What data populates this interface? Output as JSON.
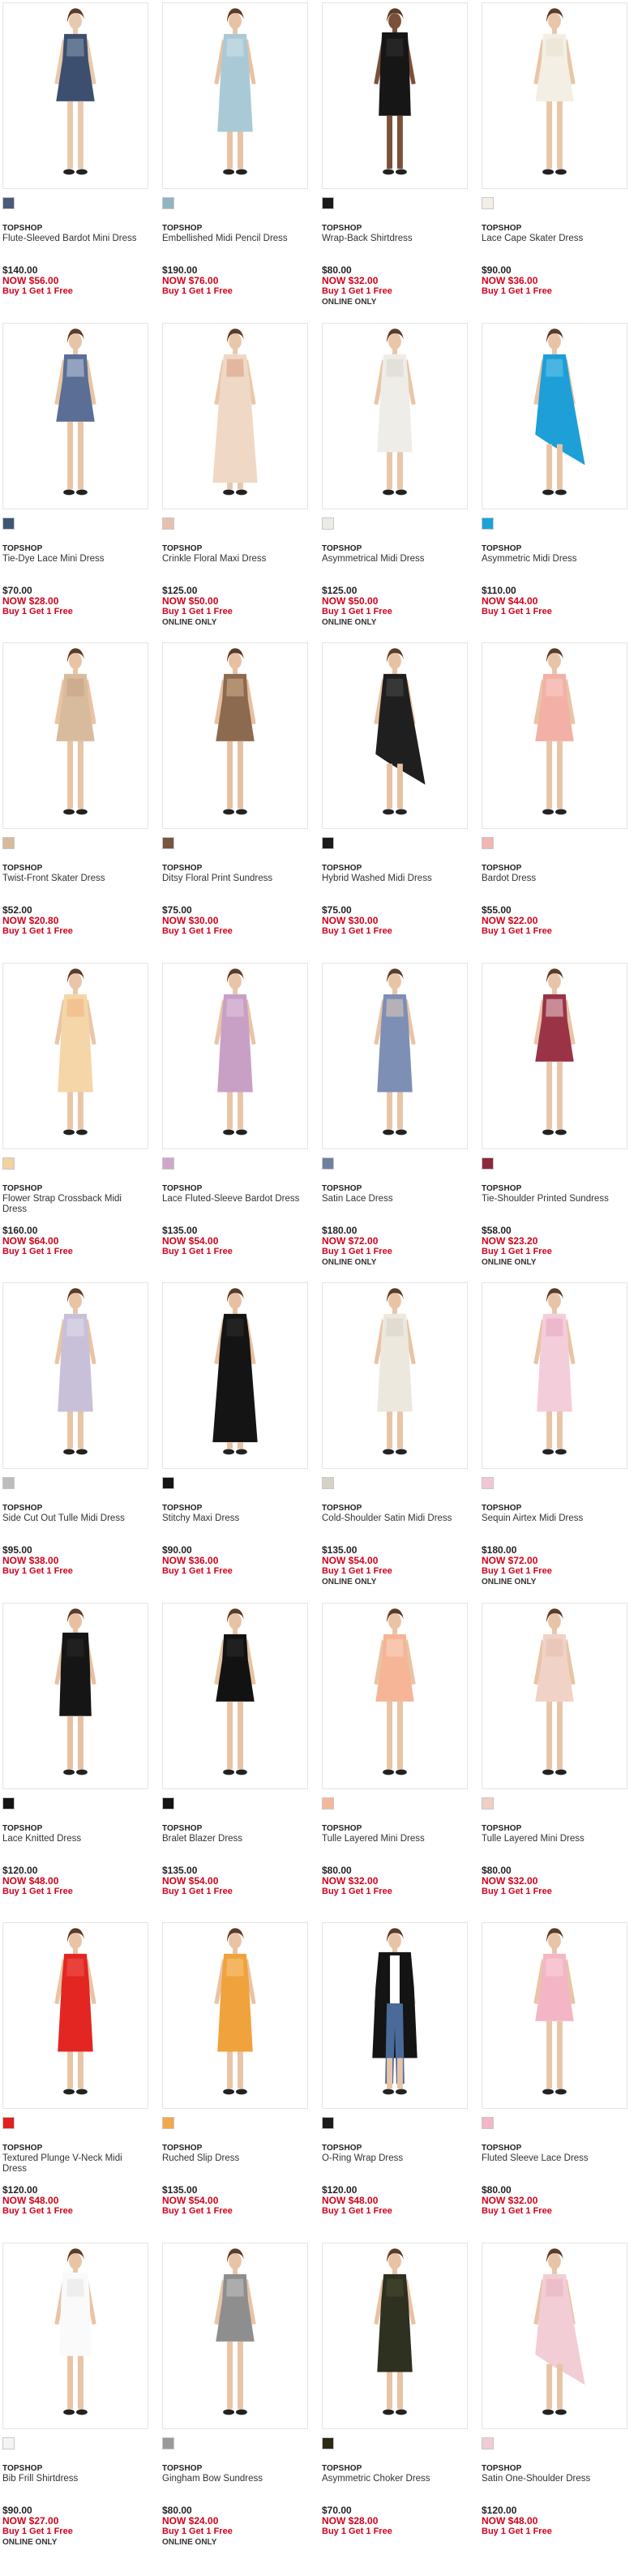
{
  "labels": {
    "now_prefix": "NOW",
    "online_only": "ONLINE ONLY"
  },
  "products": [
    {
      "brand": "TOPSHOP",
      "name": "Flute-Sleeved Bardot Mini Dress",
      "price": "$140.00",
      "now": "NOW  $56.00",
      "promo": "Buy 1 Get 1 Free",
      "online": "",
      "swatch": "#4a5a7a",
      "garment": "#3d4f6f",
      "garment_alt": "#8aa0b8",
      "skin": "#e9c9ad",
      "style": "mini"
    },
    {
      "brand": "TOPSHOP",
      "name": "Embellished Midi Pencil Dress",
      "price": "$190.00",
      "now": "NOW  $76.00",
      "promo": "Buy 1 Get 1 Free",
      "online": "",
      "swatch": "#8fb5c4",
      "garment": "#a9c9d6",
      "garment_alt": "#cfe2ea",
      "skin": "#e7c2a4",
      "style": "midi"
    },
    {
      "brand": "TOPSHOP",
      "name": "Wrap-Back Shirtdress",
      "price": "$80.00",
      "now": "NOW  $32.00",
      "promo": "Buy 1 Get 1 Free",
      "online": "ONLINE ONLY",
      "swatch": "#1a1a1a",
      "garment": "#161616",
      "garment_alt": "#333333",
      "skin": "#7a5038",
      "style": "shirt"
    },
    {
      "brand": "TOPSHOP",
      "name": "Lace Cape Skater Dress",
      "price": "$90.00",
      "now": "NOW  $36.00",
      "promo": "Buy 1 Get 1 Free",
      "online": "",
      "swatch": "#f2efe6",
      "garment": "#f3efe4",
      "garment_alt": "#e6e0d0",
      "skin": "#e8c6a8",
      "style": "mini"
    },
    {
      "brand": "TOPSHOP",
      "name": "Tie-Dye Lace Mini Dress",
      "price": "$70.00",
      "now": "NOW  $28.00",
      "promo": "Buy 1 Get 1 Free",
      "online": "",
      "swatch": "#3f5577",
      "garment": "#5a6e96",
      "garment_alt": "#c2cde0",
      "skin": "#e8c4a6",
      "style": "mini"
    },
    {
      "brand": "TOPSHOP",
      "name": "Crinkle Floral Maxi Dress",
      "price": "$125.00",
      "now": "NOW  $50.00",
      "promo": "Buy 1 Get 1 Free",
      "online": "ONLINE ONLY",
      "swatch": "#e8c0b0",
      "garment": "#efd8c6",
      "garment_alt": "#d99c80",
      "skin": "#e9c7aa",
      "style": "maxi"
    },
    {
      "brand": "TOPSHOP",
      "name": "Asymmetrical Midi Dress",
      "price": "$125.00",
      "now": "NOW  $50.00",
      "promo": "Buy 1 Get 1 Free",
      "online": "ONLINE ONLY",
      "swatch": "#ecebe8",
      "garment": "#efede8",
      "garment_alt": "#d9d6ce",
      "skin": "#e8c6a7",
      "style": "midi"
    },
    {
      "brand": "TOPSHOP",
      "name": "Asymmetric Midi Dress",
      "price": "$110.00",
      "now": "NOW  $44.00",
      "promo": "Buy 1 Get 1 Free",
      "online": "",
      "swatch": "#1aa3d8",
      "garment": "#1e9fd8",
      "garment_alt": "#6cc7ec",
      "skin": "#e8c4a5",
      "style": "asym"
    },
    {
      "brand": "TOPSHOP",
      "name": "Twist-Front Skater Dress",
      "price": "$52.00",
      "now": "NOW  $20.80",
      "promo": "Buy 1 Get 1 Free",
      "online": "",
      "swatch": "#d8b99a",
      "garment": "#d8bb9c",
      "garment_alt": "#c4a381",
      "skin": "#e8c4a4",
      "style": "mini"
    },
    {
      "brand": "TOPSHOP",
      "name": "Ditsy Floral Print Sundress",
      "price": "$75.00",
      "now": "NOW  $30.00",
      "promo": "Buy 1 Get 1 Free",
      "online": "",
      "swatch": "#7a5640",
      "garment": "#8c6a50",
      "garment_alt": "#d4b08c",
      "skin": "#e6c0a0",
      "style": "mini"
    },
    {
      "brand": "TOPSHOP",
      "name": "Hybrid Washed Midi Dress",
      "price": "$75.00",
      "now": "NOW  $30.00",
      "promo": "Buy 1 Get 1 Free",
      "online": "",
      "swatch": "#1b1b1b",
      "garment": "#1f1f1f",
      "garment_alt": "#4a4a4a",
      "skin": "#e6c2a2",
      "style": "asym"
    },
    {
      "brand": "TOPSHOP",
      "name": "Bardot Dress",
      "price": "$55.00",
      "now": "NOW  $22.00",
      "promo": "Buy 1 Get 1 Free",
      "online": "",
      "swatch": "#f0b7b0",
      "garment": "#f2b0a6",
      "garment_alt": "#f7cfc8",
      "skin": "#e8c4a6",
      "style": "mini"
    },
    {
      "brand": "TOPSHOP",
      "name": "Flower Strap Crossback Midi Dress",
      "price": "$160.00",
      "now": "NOW  $64.00",
      "promo": "Buy 1 Get 1 Free",
      "online": "",
      "swatch": "#f3d2a0",
      "garment": "#f4d6a8",
      "garment_alt": "#f0b47c",
      "skin": "#e9c6a7",
      "style": "midi"
    },
    {
      "brand": "TOPSHOP",
      "name": "Lace Fluted-Sleeve Bardot Dress",
      "price": "$135.00",
      "now": "NOW  $54.00",
      "promo": "Buy 1 Get 1 Free",
      "online": "",
      "swatch": "#cfa6cc",
      "garment": "#c8a0c6",
      "garment_alt": "#e4c8e2",
      "skin": "#e8c5a8",
      "style": "midi"
    },
    {
      "brand": "TOPSHOP",
      "name": "Satin Lace Dress",
      "price": "$180.00",
      "now": "NOW  $72.00",
      "promo": "Buy 1 Get 1 Free",
      "online": "ONLINE ONLY",
      "swatch": "#6f7fa3",
      "garment": "#7d8fb5",
      "garment_alt": "#e6cdb8",
      "skin": "#e8c4a6",
      "style": "midi"
    },
    {
      "brand": "TOPSHOP",
      "name": "Tie-Shoulder Printed Sundress",
      "price": "$58.00",
      "now": "NOW  $23.20",
      "promo": "Buy 1 Get 1 Free",
      "online": "ONLINE ONLY",
      "swatch": "#8a2a3a",
      "garment": "#9a3346",
      "garment_alt": "#efd6da",
      "skin": "#e8c5a8",
      "style": "mini"
    },
    {
      "brand": "TOPSHOP",
      "name": "Side Cut Out Tulle Midi Dress",
      "price": "$95.00",
      "now": "NOW  $38.00",
      "promo": "Buy 1 Get 1 Free",
      "online": "",
      "swatch": "#bdbdbd",
      "garment": "#c8c0d8",
      "garment_alt": "#e2dcec",
      "skin": "#e8c4a5",
      "style": "midi"
    },
    {
      "brand": "TOPSHOP",
      "name": "Stitchy Maxi Dress",
      "price": "$90.00",
      "now": "NOW  $36.00",
      "promo": "Buy 1 Get 1 Free",
      "online": "",
      "swatch": "#151515",
      "garment": "#141414",
      "garment_alt": "#2e2e2e",
      "skin": "#e6c0a0",
      "style": "maxi"
    },
    {
      "brand": "TOPSHOP",
      "name": "Cold-Shoulder Satin Midi Dress",
      "price": "$135.00",
      "now": "NOW  $54.00",
      "promo": "Buy 1 Get 1 Free",
      "online": "ONLINE ONLY",
      "swatch": "#d6d2c8",
      "garment": "#ece8de",
      "garment_alt": "#d8d2c2",
      "skin": "#e8c4a5",
      "style": "midi"
    },
    {
      "brand": "TOPSHOP",
      "name": "Sequin Airtex Midi Dress",
      "price": "$180.00",
      "now": "NOW  $72.00",
      "promo": "Buy 1 Get 1 Free",
      "online": "ONLINE ONLY",
      "swatch": "#f2c6d6",
      "garment": "#f4cddb",
      "garment_alt": "#e8a8c0",
      "skin": "#e8c4a6",
      "style": "midi"
    },
    {
      "brand": "TOPSHOP",
      "name": "Lace Knitted Dress",
      "price": "$120.00",
      "now": "NOW  $48.00",
      "promo": "Buy 1 Get 1 Free",
      "online": "",
      "swatch": "#141414",
      "garment": "#151515",
      "garment_alt": "#2a2a2a",
      "skin": "#e6c0a0",
      "style": "shirt"
    },
    {
      "brand": "TOPSHOP",
      "name": "Bralet Blazer Dress",
      "price": "$135.00",
      "now": "NOW  $54.00",
      "promo": "Buy 1 Get 1 Free",
      "online": "",
      "swatch": "#141414",
      "garment": "#121212",
      "garment_alt": "#2c2c2c",
      "skin": "#e7c3a3",
      "style": "mini"
    },
    {
      "brand": "TOPSHOP",
      "name": "Tulle Layered Mini Dress",
      "price": "$80.00",
      "now": "NOW  $32.00",
      "promo": "Buy 1 Get 1 Free",
      "online": "",
      "swatch": "#f4b89c",
      "garment": "#f5b596",
      "garment_alt": "#f9d6c4",
      "skin": "#e8c4a4",
      "style": "mini"
    },
    {
      "brand": "TOPSHOP",
      "name": "Tulle Layered Mini Dress",
      "price": "$80.00",
      "now": "NOW  $32.00",
      "promo": "Buy 1 Get 1 Free",
      "online": "",
      "swatch": "#f0cfc4",
      "garment": "#f0d3c6",
      "garment_alt": "#e6bfae",
      "skin": "#e8c4a6",
      "style": "mini"
    },
    {
      "brand": "TOPSHOP",
      "name": "Textured Plunge V-Neck Midi Dress",
      "price": "$120.00",
      "now": "NOW  $48.00",
      "promo": "Buy 1 Get 1 Free",
      "online": "",
      "swatch": "#e02020",
      "garment": "#e32622",
      "garment_alt": "#f05a50",
      "skin": "#e8c4a4",
      "style": "midi"
    },
    {
      "brand": "TOPSHOP",
      "name": "Ruched Slip Dress",
      "price": "$135.00",
      "now": "NOW  $54.00",
      "promo": "Buy 1 Get 1 Free",
      "online": "",
      "swatch": "#f2a84a",
      "garment": "#f0a23c",
      "garment_alt": "#f8c77e",
      "skin": "#e8c4a4",
      "style": "midi"
    },
    {
      "brand": "TOPSHOP",
      "name": "O-Ring Wrap Dress",
      "price": "$120.00",
      "now": "NOW  $48.00",
      "promo": "Buy 1 Get 1 Free",
      "online": "",
      "swatch": "#1c1c1c",
      "garment": "#141414",
      "garment_alt": "#4a6a9a",
      "skin": "#e8c4a6",
      "style": "coat"
    },
    {
      "brand": "TOPSHOP",
      "name": "Fluted Sleeve Lace Dress",
      "price": "$80.00",
      "now": "NOW  $32.00",
      "promo": "Buy 1 Get 1 Free",
      "online": "",
      "swatch": "#f2b8c8",
      "garment": "#f4b6c6",
      "garment_alt": "#fad4de",
      "skin": "#e8c5a7",
      "style": "mini"
    },
    {
      "brand": "TOPSHOP",
      "name": "Bib Frill Shirtdress",
      "price": "$90.00",
      "now": "NOW  $27.00",
      "promo": "Buy 1 Get 1 Free",
      "online": "ONLINE ONLY",
      "swatch": "#f4f4f4",
      "garment": "#fafafa",
      "garment_alt": "#e4e4e4",
      "skin": "#e8c4a5",
      "style": "shirt"
    },
    {
      "brand": "TOPSHOP",
      "name": "Gingham Bow Sundress",
      "price": "$80.00",
      "now": "NOW  $24.00",
      "promo": "Buy 1 Get 1 Free",
      "online": "ONLINE ONLY",
      "swatch": "#9a9a9a",
      "garment": "#8e8e8e",
      "garment_alt": "#c4c4c4",
      "skin": "#e8c4a6",
      "style": "mini"
    },
    {
      "brand": "TOPSHOP",
      "name": "Asymmetric Choker Dress",
      "price": "$70.00",
      "now": "NOW  $28.00",
      "promo": "Buy 1 Get 1 Free",
      "online": "",
      "swatch": "#2c2a16",
      "garment": "#2e3020",
      "garment_alt": "#4a4c32",
      "skin": "#e7c2a3",
      "style": "midi"
    },
    {
      "brand": "TOPSHOP",
      "name": "Satin One-Shoulder Dress",
      "price": "$120.00",
      "now": "NOW  $48.00",
      "promo": "Buy 1 Get 1 Free",
      "online": "",
      "swatch": "#f0ccd4",
      "garment": "#f2cdd6",
      "garment_alt": "#e8b2c0",
      "skin": "#e8c4a6",
      "style": "asym"
    }
  ]
}
